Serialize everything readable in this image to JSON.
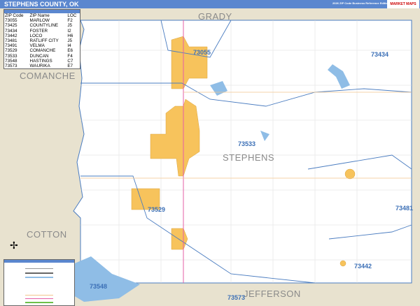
{
  "header": {
    "title": "STEPHENS COUNTY, OK",
    "edition": "2026 ZIP Code Business Reference Edition",
    "logo": "MARKET MAPS"
  },
  "regions": {
    "north": "GRADY",
    "west_upper": "COMANCHE",
    "west_lower": "COTTON",
    "south": "JEFFERSON",
    "county": "STEPHENS"
  },
  "zip_labels": [
    "73055",
    "73434",
    "73533",
    "73481",
    "73529",
    "73442",
    "73548",
    "73573"
  ],
  "index": {
    "columns": [
      "ZIP Code",
      "ZIP Name",
      "LOC"
    ],
    "rows": [
      [
        "73055",
        "MARLOW",
        "F2"
      ],
      [
        "73425",
        "COUNTYLINE",
        "J5"
      ],
      [
        "73434",
        "FOSTER",
        "I2"
      ],
      [
        "73442",
        "LOCO",
        "H6"
      ],
      [
        "73481",
        "RATLIFF CITY",
        "J5"
      ],
      [
        "73491",
        "VELMA",
        "I4"
      ],
      [
        "73529",
        "COMANCHE",
        "E6"
      ],
      [
        "73533",
        "DUNCAN",
        "F4"
      ],
      [
        "73548",
        "HASTINGS",
        "C7"
      ],
      [
        "73573",
        "WAURIKA",
        "E7"
      ]
    ]
  },
  "colors": {
    "header": "#5b87cf",
    "city": "#f7c35c",
    "water": "#8fbde6",
    "zip_boundary": "#4a7cc0",
    "land_outside": "#e8e2cf"
  }
}
